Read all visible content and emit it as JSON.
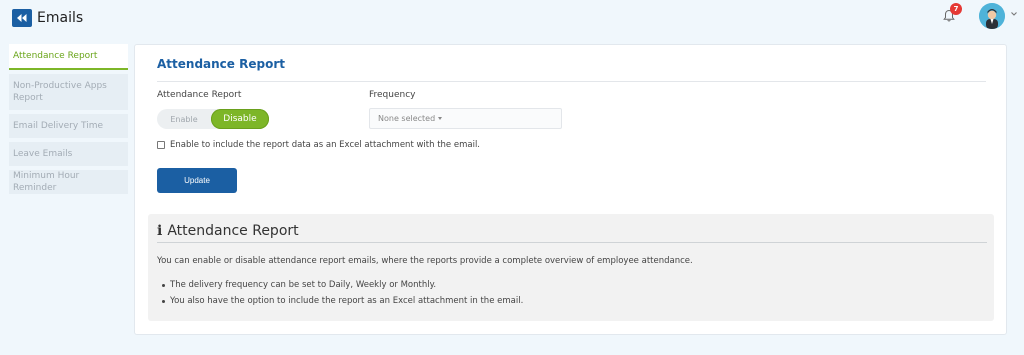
{
  "header": {
    "title": "Emails",
    "notification_count": "7",
    "icons": {
      "back": "double-chevron-left-icon",
      "bell": "bell-icon",
      "avatar": "user-avatar",
      "chevron": "chevron-down-icon"
    },
    "accent": "#1b5fa3"
  },
  "sidebar": {
    "items": [
      {
        "label": "Attendance Report",
        "active": true
      },
      {
        "label": "Non-Productive Apps Report",
        "active": false
      },
      {
        "label": "Email Delivery Time",
        "active": false
      },
      {
        "label": "Leave Emails",
        "active": false
      },
      {
        "label": "Minimum Hour Reminder",
        "active": false
      }
    ],
    "active_color": "#6aa51a"
  },
  "main": {
    "title": "Attendance Report",
    "report_label": "Attendance Report",
    "toggle": {
      "enable_label": "Enable",
      "disable_label": "Disable",
      "selected": "Disable",
      "selected_color": "#7db628"
    },
    "frequency_label": "Frequency",
    "frequency_value": "None selected",
    "excel_checkbox_label": "Enable to include the report data as an Excel attachment with the email.",
    "excel_checked": false,
    "update_label": "Update"
  },
  "info": {
    "icon": "info-icon",
    "icon_glyph": "i",
    "title": "Attendance Report",
    "description": "You can enable or disable attendance report emails, where the reports provide a complete overview of employee attendance.",
    "points": [
      "The delivery frequency can be set to Daily, Weekly or Monthly.",
      "You also have the option to include the report as an Excel attachment in the email."
    ]
  }
}
